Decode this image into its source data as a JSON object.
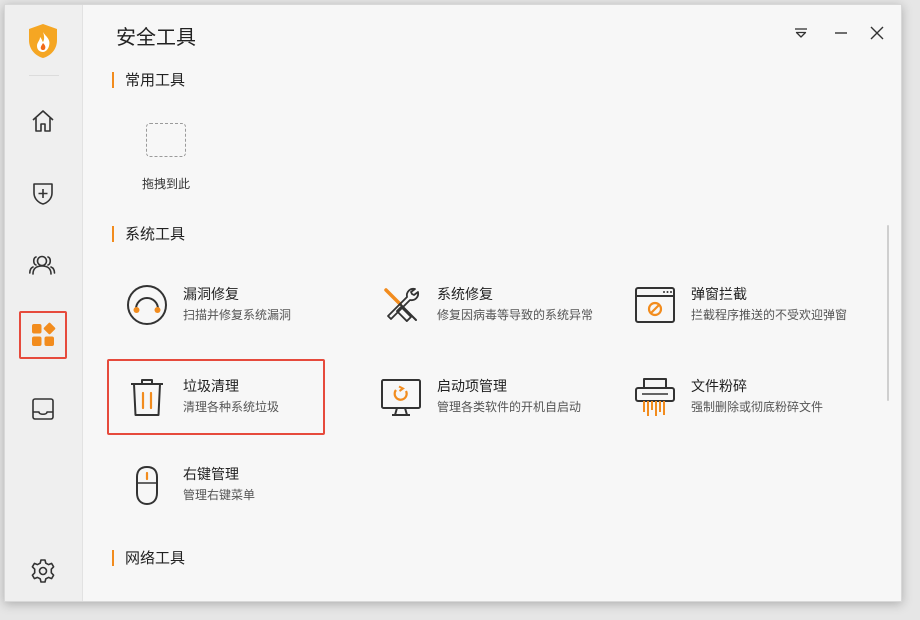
{
  "window": {
    "title": "安全工具"
  },
  "sidebar": {
    "items": [
      {
        "icon": "home-icon"
      },
      {
        "icon": "shield-plus-icon"
      },
      {
        "icon": "users-icon"
      },
      {
        "icon": "apps-icon",
        "active": true
      },
      {
        "icon": "inbox-icon"
      }
    ],
    "settings_icon": "gear-icon"
  },
  "common_tools": {
    "header": "常用工具",
    "drop_label": "拖拽到此"
  },
  "system_tools": {
    "header": "系统工具",
    "items": [
      {
        "name": "漏洞修复",
        "desc": "扫描并修复系统漏洞",
        "icon": "vulnerability-fix-icon"
      },
      {
        "name": "系统修复",
        "desc": "修复因病毒等导致的系统异常",
        "icon": "tools-icon"
      },
      {
        "name": "弹窗拦截",
        "desc": "拦截程序推送的不受欢迎弹窗",
        "icon": "popup-block-icon"
      },
      {
        "name": "垃圾清理",
        "desc": "清理各种系统垃圾",
        "icon": "trash-icon",
        "selected": true
      },
      {
        "name": "启动项管理",
        "desc": "管理各类软件的开机自启动",
        "icon": "startup-monitor-icon"
      },
      {
        "name": "文件粉碎",
        "desc": "强制删除或彻底粉碎文件",
        "icon": "shredder-icon"
      },
      {
        "name": "右键管理",
        "desc": "管理右键菜单",
        "icon": "mouse-icon"
      }
    ]
  },
  "network_tools": {
    "header": "网络工具"
  },
  "colors": {
    "accent": "#f28c1e",
    "highlight": "#e64a3c"
  }
}
